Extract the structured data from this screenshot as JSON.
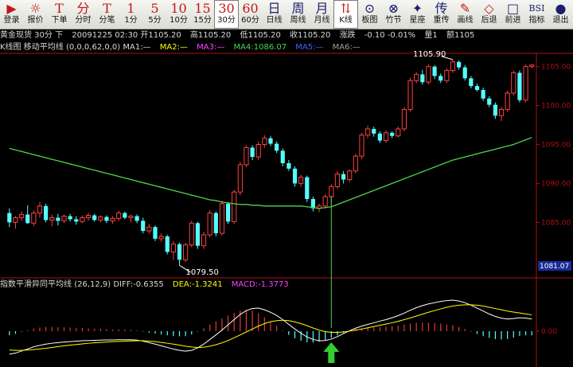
{
  "toolbar": {
    "items": [
      {
        "glyph": "▶",
        "label": "登录",
        "color": "red"
      },
      {
        "glyph": "☼",
        "label": "报价",
        "color": "red"
      },
      {
        "glyph": "T",
        "label": "下单",
        "color": "red"
      },
      {
        "glyph": "分",
        "label": "分时",
        "color": "red"
      },
      {
        "glyph": "T",
        "label": "分笔",
        "color": "red"
      },
      {
        "glyph": "1",
        "label": "1分",
        "color": "red"
      },
      {
        "glyph": "5",
        "label": "5分",
        "color": "red"
      },
      {
        "glyph": "10",
        "label": "10分",
        "color": "red"
      },
      {
        "glyph": "15",
        "label": "15分",
        "color": "red"
      },
      {
        "glyph": "30",
        "label": "30分",
        "color": "red",
        "active": true
      },
      {
        "glyph": "60",
        "label": "60分",
        "color": "red"
      },
      {
        "glyph": "日",
        "label": "日线",
        "color": "dark"
      },
      {
        "glyph": "周",
        "label": "周线",
        "color": "dark"
      },
      {
        "glyph": "月",
        "label": "月线",
        "color": "dark"
      },
      {
        "glyph": "⇅",
        "label": "K线",
        "color": "red",
        "active": true
      },
      {
        "glyph": "⊙",
        "label": "板图",
        "color": "dark"
      },
      {
        "glyph": "⊗",
        "label": "竹节",
        "color": "dark"
      },
      {
        "glyph": "✦",
        "label": "星座",
        "color": "dark"
      },
      {
        "glyph": "传",
        "label": "重传",
        "color": "dark"
      },
      {
        "glyph": "✎",
        "label": "画线",
        "color": "red"
      },
      {
        "glyph": "◇",
        "label": "后退",
        "color": "red"
      },
      {
        "glyph": "□",
        "label": "前进",
        "color": "dark"
      },
      {
        "glyph": "BSI",
        "label": "指标",
        "color": "dark"
      },
      {
        "glyph": "●",
        "label": "退出",
        "color": "dark"
      }
    ]
  },
  "infobar": {
    "symbol": "黄金现货 30分 下",
    "datetime": "20091225 02:30",
    "open": "开1105.20",
    "high": "高1105.20",
    "low": "低1105.20",
    "close": "收1105.20",
    "change_label": "涨跌",
    "change": "-0.10",
    "change_pct": "-0.01%",
    "volume": "量1",
    "amount": "额1105"
  },
  "mabar": {
    "title": "K线图",
    "name": "移动平均线",
    "params": "(0,0,0,62,0,0)",
    "ma1": "MA1:—",
    "ma2": "MA2:—",
    "ma3": "MA3:—",
    "ma4": "MA4:1086.07",
    "ma5": "MA5:—",
    "ma6": "MA6:—"
  },
  "macdbar": {
    "name": "指数平滑异同平均线",
    "params": "(26,12,9)",
    "diff": "DIFF:-0.6355",
    "dea": "DEA:-1.3241",
    "macd": "MACD:-1.3773"
  },
  "colors": {
    "up": "#ff4040",
    "down": "#54ffff",
    "ma4": "#4cd64c",
    "diff": "#ffffff",
    "dea": "#ffff00",
    "macd_up": "#e23a3a",
    "macd_down": "#54ffff",
    "axis": "#b01010",
    "crosshair": "#4cd64c",
    "arrow": "#33cc33"
  },
  "chart_data": [
    {
      "type": "candlestick",
      "title": "K线图",
      "y_axis": {
        "ticks": [
          1085.0,
          1090.0,
          1095.0,
          1100.0,
          1105.0
        ],
        "labels": [
          "1085.00",
          "1090.00",
          "1095.00",
          "1100.00",
          "1105.00"
        ],
        "ylim": [
          1078.8,
          1106.6
        ]
      },
      "cursor_label": "1081.07",
      "annotations": [
        {
          "text": "1105.90",
          "x_index": 73,
          "y": 1105.9
        },
        {
          "text": "1079.50",
          "x_index": 28,
          "y": 1079.5
        }
      ],
      "candles": [
        {
          "o": 1086.2,
          "h": 1086.8,
          "l": 1084.4,
          "c": 1085.0
        },
        {
          "o": 1085.0,
          "h": 1085.8,
          "l": 1084.2,
          "c": 1085.6
        },
        {
          "o": 1085.6,
          "h": 1086.4,
          "l": 1085.2,
          "c": 1086.0
        },
        {
          "o": 1086.0,
          "h": 1087.2,
          "l": 1084.8,
          "c": 1084.9
        },
        {
          "o": 1084.9,
          "h": 1086.6,
          "l": 1084.5,
          "c": 1086.2
        },
        {
          "o": 1086.2,
          "h": 1087.6,
          "l": 1085.6,
          "c": 1087.1
        },
        {
          "o": 1087.1,
          "h": 1087.4,
          "l": 1085.0,
          "c": 1085.3
        },
        {
          "o": 1085.3,
          "h": 1086.0,
          "l": 1084.5,
          "c": 1085.6
        },
        {
          "o": 1085.6,
          "h": 1086.1,
          "l": 1084.6,
          "c": 1085.2
        },
        {
          "o": 1085.2,
          "h": 1086.0,
          "l": 1084.9,
          "c": 1085.8
        },
        {
          "o": 1085.8,
          "h": 1086.1,
          "l": 1085.1,
          "c": 1085.4
        },
        {
          "o": 1085.4,
          "h": 1085.8,
          "l": 1084.7,
          "c": 1085.1
        },
        {
          "o": 1085.1,
          "h": 1085.9,
          "l": 1084.9,
          "c": 1085.6
        },
        {
          "o": 1085.6,
          "h": 1086.2,
          "l": 1085.2,
          "c": 1085.9
        },
        {
          "o": 1085.9,
          "h": 1086.1,
          "l": 1085.1,
          "c": 1085.3
        },
        {
          "o": 1085.3,
          "h": 1085.9,
          "l": 1085.0,
          "c": 1085.7
        },
        {
          "o": 1085.7,
          "h": 1085.9,
          "l": 1084.9,
          "c": 1085.2
        },
        {
          "o": 1085.2,
          "h": 1085.8,
          "l": 1084.8,
          "c": 1085.5
        },
        {
          "o": 1085.5,
          "h": 1086.5,
          "l": 1085.2,
          "c": 1086.2
        },
        {
          "o": 1086.2,
          "h": 1086.4,
          "l": 1085.4,
          "c": 1085.6
        },
        {
          "o": 1085.6,
          "h": 1086.0,
          "l": 1085.0,
          "c": 1085.8
        },
        {
          "o": 1085.8,
          "h": 1086.0,
          "l": 1084.9,
          "c": 1085.2
        },
        {
          "o": 1085.2,
          "h": 1085.6,
          "l": 1083.6,
          "c": 1083.9
        },
        {
          "o": 1083.9,
          "h": 1084.8,
          "l": 1083.5,
          "c": 1084.4
        },
        {
          "o": 1084.4,
          "h": 1084.6,
          "l": 1082.6,
          "c": 1082.9
        },
        {
          "o": 1082.9,
          "h": 1083.6,
          "l": 1082.5,
          "c": 1083.2
        },
        {
          "o": 1083.2,
          "h": 1083.4,
          "l": 1080.9,
          "c": 1081.2
        },
        {
          "o": 1081.2,
          "h": 1082.6,
          "l": 1080.2,
          "c": 1082.2
        },
        {
          "o": 1082.2,
          "h": 1082.4,
          "l": 1079.5,
          "c": 1080.2
        },
        {
          "o": 1080.2,
          "h": 1082.4,
          "l": 1079.9,
          "c": 1082.1
        },
        {
          "o": 1082.1,
          "h": 1085.2,
          "l": 1081.8,
          "c": 1084.9
        },
        {
          "o": 1084.9,
          "h": 1085.1,
          "l": 1081.6,
          "c": 1082.0
        },
        {
          "o": 1082.0,
          "h": 1083.8,
          "l": 1081.6,
          "c": 1083.4
        },
        {
          "o": 1083.4,
          "h": 1086.6,
          "l": 1083.1,
          "c": 1086.2
        },
        {
          "o": 1086.2,
          "h": 1086.4,
          "l": 1083.2,
          "c": 1083.6
        },
        {
          "o": 1083.6,
          "h": 1087.8,
          "l": 1083.3,
          "c": 1087.4
        },
        {
          "o": 1087.4,
          "h": 1087.6,
          "l": 1084.8,
          "c": 1085.1
        },
        {
          "o": 1085.1,
          "h": 1089.2,
          "l": 1084.8,
          "c": 1088.9
        },
        {
          "o": 1088.9,
          "h": 1092.8,
          "l": 1088.5,
          "c": 1092.4
        },
        {
          "o": 1092.4,
          "h": 1094.9,
          "l": 1092.1,
          "c": 1094.6
        },
        {
          "o": 1094.6,
          "h": 1094.9,
          "l": 1093.0,
          "c": 1093.4
        },
        {
          "o": 1093.4,
          "h": 1095.4,
          "l": 1093.0,
          "c": 1095.0
        },
        {
          "o": 1095.0,
          "h": 1096.2,
          "l": 1094.6,
          "c": 1095.8
        },
        {
          "o": 1095.8,
          "h": 1096.1,
          "l": 1094.8,
          "c": 1095.1
        },
        {
          "o": 1095.1,
          "h": 1095.4,
          "l": 1093.9,
          "c": 1094.2
        },
        {
          "o": 1094.2,
          "h": 1094.5,
          "l": 1092.2,
          "c": 1092.6
        },
        {
          "o": 1092.6,
          "h": 1093.0,
          "l": 1091.6,
          "c": 1091.9
        },
        {
          "o": 1091.9,
          "h": 1092.2,
          "l": 1089.6,
          "c": 1090.0
        },
        {
          "o": 1090.0,
          "h": 1091.1,
          "l": 1089.6,
          "c": 1090.8
        },
        {
          "o": 1090.8,
          "h": 1091.0,
          "l": 1087.6,
          "c": 1088.0
        },
        {
          "o": 1088.0,
          "h": 1088.3,
          "l": 1086.4,
          "c": 1086.8
        },
        {
          "o": 1086.8,
          "h": 1087.4,
          "l": 1086.3,
          "c": 1087.1
        },
        {
          "o": 1087.1,
          "h": 1088.6,
          "l": 1086.8,
          "c": 1088.3
        },
        {
          "o": 1088.3,
          "h": 1089.9,
          "l": 1087.2,
          "c": 1089.6
        },
        {
          "o": 1089.6,
          "h": 1091.6,
          "l": 1089.3,
          "c": 1091.2
        },
        {
          "o": 1091.2,
          "h": 1091.6,
          "l": 1090.0,
          "c": 1090.5
        },
        {
          "o": 1090.5,
          "h": 1091.8,
          "l": 1090.2,
          "c": 1091.6
        },
        {
          "o": 1091.6,
          "h": 1093.8,
          "l": 1091.3,
          "c": 1093.5
        },
        {
          "o": 1093.5,
          "h": 1096.5,
          "l": 1093.1,
          "c": 1096.2
        },
        {
          "o": 1096.2,
          "h": 1097.4,
          "l": 1095.8,
          "c": 1097.0
        },
        {
          "o": 1097.0,
          "h": 1097.3,
          "l": 1096.0,
          "c": 1096.4
        },
        {
          "o": 1096.4,
          "h": 1096.7,
          "l": 1095.2,
          "c": 1095.5
        },
        {
          "o": 1095.5,
          "h": 1096.8,
          "l": 1095.2,
          "c": 1096.5
        },
        {
          "o": 1096.5,
          "h": 1096.7,
          "l": 1095.8,
          "c": 1096.1
        },
        {
          "o": 1096.1,
          "h": 1097.3,
          "l": 1095.9,
          "c": 1097.0
        },
        {
          "o": 1097.0,
          "h": 1099.8,
          "l": 1096.7,
          "c": 1099.5
        },
        {
          "o": 1099.5,
          "h": 1103.6,
          "l": 1099.2,
          "c": 1103.2
        },
        {
          "o": 1103.2,
          "h": 1104.3,
          "l": 1102.9,
          "c": 1104.0
        },
        {
          "o": 1104.0,
          "h": 1104.6,
          "l": 1102.7,
          "c": 1103.0
        },
        {
          "o": 1103.0,
          "h": 1105.3,
          "l": 1102.7,
          "c": 1105.0
        },
        {
          "o": 1105.0,
          "h": 1105.2,
          "l": 1103.4,
          "c": 1103.8
        },
        {
          "o": 1103.8,
          "h": 1104.1,
          "l": 1102.9,
          "c": 1103.2
        },
        {
          "o": 1103.2,
          "h": 1104.8,
          "l": 1102.9,
          "c": 1104.5
        },
        {
          "o": 1104.5,
          "h": 1105.9,
          "l": 1104.2,
          "c": 1105.6
        },
        {
          "o": 1105.6,
          "h": 1105.8,
          "l": 1104.6,
          "c": 1104.9
        },
        {
          "o": 1104.9,
          "h": 1105.2,
          "l": 1103.2,
          "c": 1103.5
        },
        {
          "o": 1103.5,
          "h": 1103.8,
          "l": 1102.2,
          "c": 1102.5
        },
        {
          "o": 1102.5,
          "h": 1102.8,
          "l": 1101.8,
          "c": 1102.0
        },
        {
          "o": 1102.0,
          "h": 1102.3,
          "l": 1100.6,
          "c": 1100.9
        },
        {
          "o": 1100.9,
          "h": 1101.2,
          "l": 1099.8,
          "c": 1100.1
        },
        {
          "o": 1100.1,
          "h": 1100.4,
          "l": 1098.3,
          "c": 1098.7
        },
        {
          "o": 1098.7,
          "h": 1099.8,
          "l": 1098.0,
          "c": 1099.5
        },
        {
          "o": 1099.5,
          "h": 1101.9,
          "l": 1099.2,
          "c": 1101.6
        },
        {
          "o": 1101.6,
          "h": 1104.5,
          "l": 1101.3,
          "c": 1104.2
        },
        {
          "o": 1104.2,
          "h": 1104.5,
          "l": 1100.4,
          "c": 1100.7
        },
        {
          "o": 1100.7,
          "h": 1105.3,
          "l": 1100.4,
          "c": 1105.0
        },
        {
          "o": 1105.0,
          "h": 1105.3,
          "l": 1104.8,
          "c": 1105.2
        }
      ],
      "ma4": [
        1094.5,
        1094.3,
        1094.1,
        1093.9,
        1093.7,
        1093.5,
        1093.3,
        1093.1,
        1092.9,
        1092.7,
        1092.5,
        1092.3,
        1092.1,
        1091.9,
        1091.7,
        1091.5,
        1091.3,
        1091.1,
        1090.9,
        1090.7,
        1090.5,
        1090.3,
        1090.1,
        1089.9,
        1089.7,
        1089.5,
        1089.3,
        1089.1,
        1088.9,
        1088.7,
        1088.5,
        1088.3,
        1088.1,
        1087.9,
        1087.8,
        1087.6,
        1087.5,
        1087.4,
        1087.3,
        1087.3,
        1087.2,
        1087.2,
        1087.1,
        1087.1,
        1087.1,
        1087.1,
        1087.1,
        1087.1,
        1087.1,
        1087.0,
        1086.9,
        1086.8,
        1086.9,
        1087.0,
        1087.3,
        1087.6,
        1087.9,
        1088.2,
        1088.5,
        1088.8,
        1089.1,
        1089.4,
        1089.7,
        1090.0,
        1090.3,
        1090.6,
        1090.9,
        1091.2,
        1091.5,
        1091.8,
        1092.1,
        1092.4,
        1092.7,
        1093.0,
        1093.2,
        1093.4,
        1093.6,
        1093.8,
        1094.0,
        1094.2,
        1094.4,
        1094.6,
        1094.8,
        1095.0,
        1095.3,
        1095.6,
        1095.9
      ],
      "crosshair_index": 53
    },
    {
      "type": "macd",
      "title": "指数平滑异同平均线",
      "ylim": [
        -1.6,
        1.9
      ],
      "tick_label": "0.00",
      "diff": [
        -1.1,
        -1.05,
        -0.95,
        -0.85,
        -0.75,
        -0.68,
        -0.62,
        -0.58,
        -0.55,
        -0.52,
        -0.5,
        -0.48,
        -0.46,
        -0.45,
        -0.44,
        -0.43,
        -0.42,
        -0.42,
        -0.41,
        -0.41,
        -0.41,
        -0.43,
        -0.48,
        -0.55,
        -0.62,
        -0.7,
        -0.78,
        -0.86,
        -0.92,
        -0.96,
        -0.92,
        -0.8,
        -0.62,
        -0.4,
        -0.18,
        0.05,
        0.3,
        0.55,
        0.8,
        0.98,
        1.08,
        1.1,
        1.02,
        0.9,
        0.75,
        0.55,
        0.32,
        0.1,
        -0.1,
        -0.28,
        -0.4,
        -0.46,
        -0.45,
        -0.38,
        -0.26,
        -0.12,
        0.02,
        0.14,
        0.24,
        0.32,
        0.4,
        0.48,
        0.55,
        0.64,
        0.74,
        0.86,
        1.0,
        1.12,
        1.22,
        1.3,
        1.36,
        1.42,
        1.46,
        1.48,
        1.44,
        1.36,
        1.24,
        1.1,
        0.96,
        0.82,
        0.7,
        0.62,
        0.58,
        0.6,
        0.64,
        0.62,
        0.58
      ],
      "dea": [
        -0.9,
        -0.92,
        -0.92,
        -0.9,
        -0.88,
        -0.85,
        -0.82,
        -0.78,
        -0.74,
        -0.7,
        -0.67,
        -0.64,
        -0.61,
        -0.58,
        -0.56,
        -0.54,
        -0.52,
        -0.5,
        -0.49,
        -0.48,
        -0.47,
        -0.46,
        -0.46,
        -0.48,
        -0.5,
        -0.54,
        -0.58,
        -0.62,
        -0.67,
        -0.72,
        -0.76,
        -0.78,
        -0.77,
        -0.72,
        -0.65,
        -0.56,
        -0.45,
        -0.32,
        -0.18,
        -0.04,
        0.1,
        0.24,
        0.36,
        0.45,
        0.5,
        0.52,
        0.5,
        0.44,
        0.36,
        0.26,
        0.15,
        0.05,
        -0.02,
        -0.06,
        -0.06,
        -0.04,
        0.0,
        0.05,
        0.1,
        0.16,
        0.22,
        0.28,
        0.34,
        0.4,
        0.47,
        0.55,
        0.63,
        0.72,
        0.81,
        0.9,
        0.98,
        1.06,
        1.14,
        1.2,
        1.24,
        1.26,
        1.26,
        1.24,
        1.2,
        1.14,
        1.08,
        1.02,
        0.96,
        0.91,
        0.87,
        0.82,
        0.78
      ],
      "hist": [
        -0.2,
        -0.13,
        -0.03,
        0.05,
        0.13,
        0.17,
        0.2,
        0.2,
        0.19,
        0.18,
        0.17,
        0.16,
        0.15,
        0.13,
        0.12,
        0.11,
        0.1,
        0.08,
        0.08,
        0.07,
        0.06,
        0.03,
        -0.02,
        -0.07,
        -0.12,
        -0.16,
        -0.2,
        -0.24,
        -0.25,
        -0.24,
        -0.16,
        -0.02,
        0.15,
        0.32,
        0.47,
        0.61,
        0.75,
        0.87,
        0.98,
        1.02,
        0.98,
        0.86,
        0.66,
        0.45,
        0.25,
        0.03,
        -0.18,
        -0.34,
        -0.46,
        -0.54,
        -0.55,
        -0.51,
        -0.43,
        -0.32,
        -0.2,
        -0.08,
        0.02,
        0.09,
        0.14,
        0.16,
        0.18,
        0.2,
        0.21,
        0.24,
        0.27,
        0.31,
        0.37,
        0.4,
        0.41,
        0.4,
        0.38,
        0.36,
        0.32,
        0.28,
        0.2,
        0.1,
        -0.02,
        -0.14,
        -0.24,
        -0.32,
        -0.38,
        -0.4,
        -0.38,
        -0.31,
        -0.23,
        -0.2,
        -0.2
      ]
    }
  ]
}
